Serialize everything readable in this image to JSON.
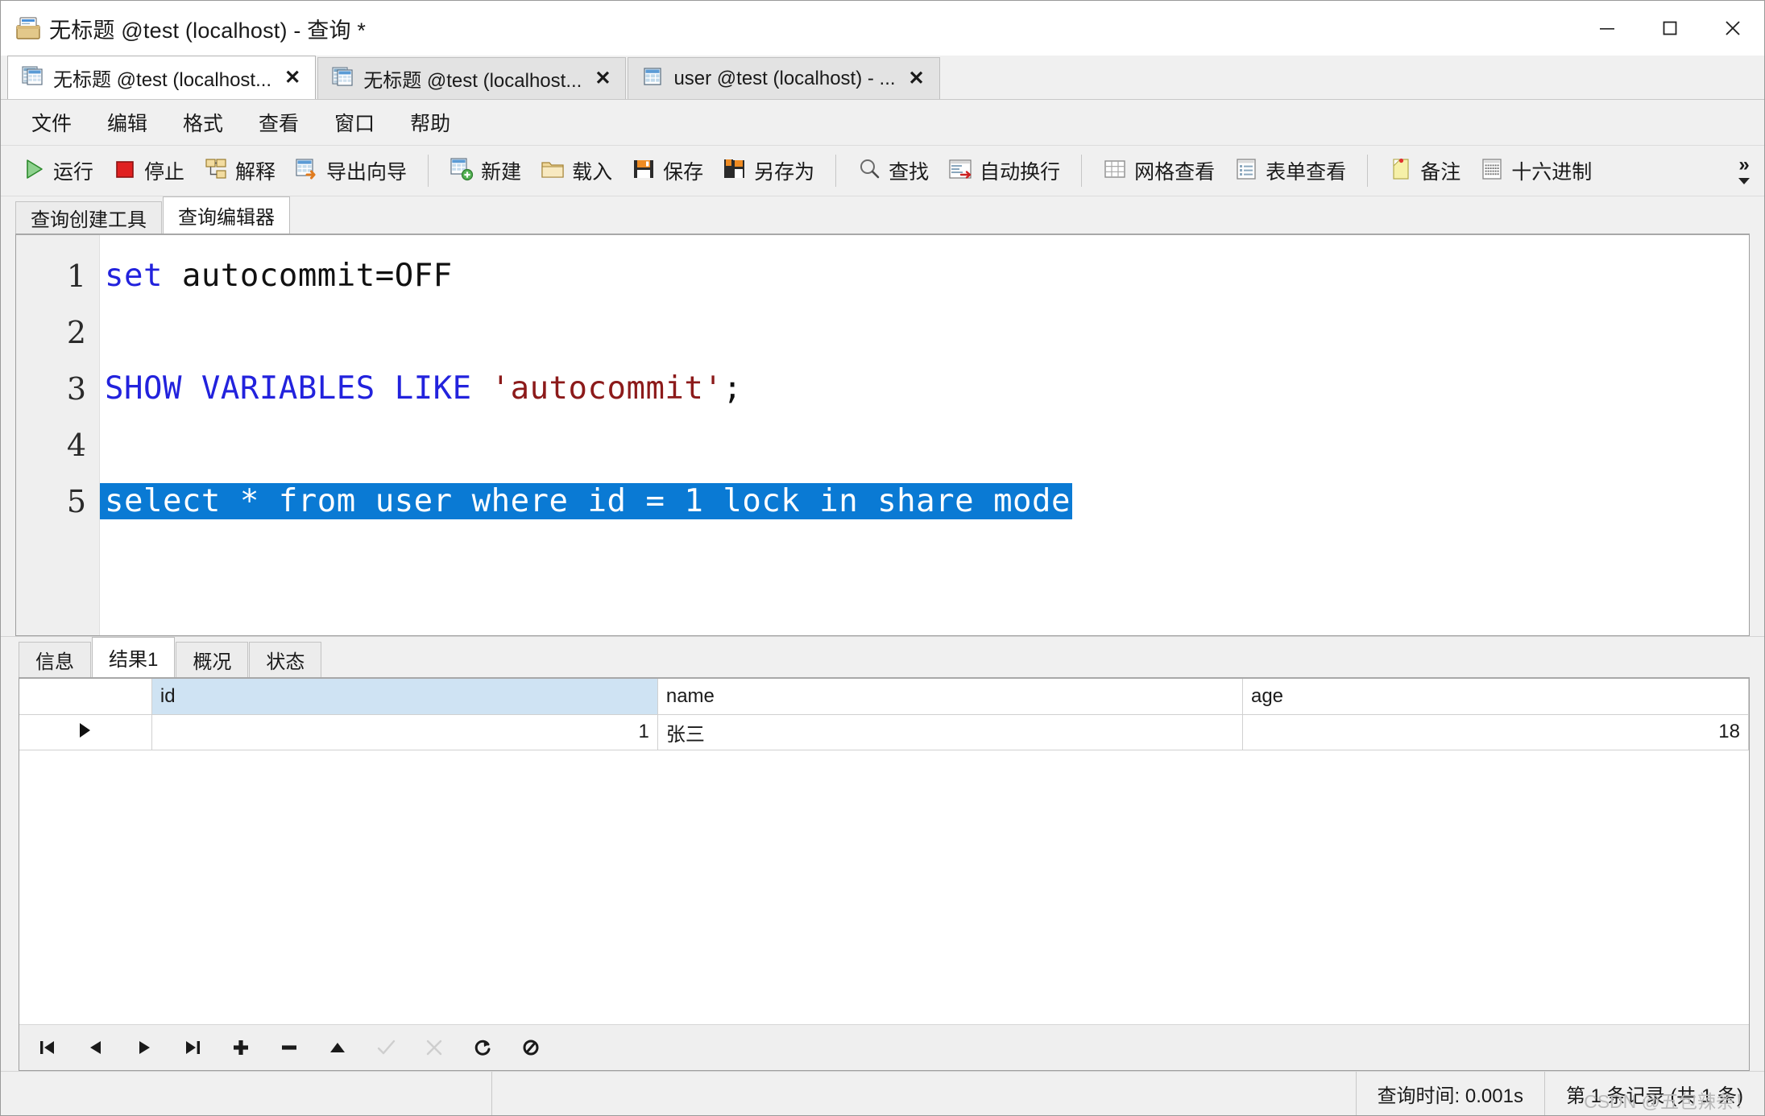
{
  "window": {
    "title": "无标题 @test (localhost) - 查询 *",
    "icon": "query-window-icon",
    "controls": {
      "minimize": "minimize-icon",
      "maximize": "maximize-icon",
      "close": "close-icon"
    }
  },
  "document_tabs": [
    {
      "label": "无标题 @test (localhost...",
      "close": "✕",
      "icon": "query-tab-icon",
      "active": true
    },
    {
      "label": "无标题 @test (localhost...",
      "close": "✕",
      "icon": "query-tab-icon",
      "active": false
    },
    {
      "label": "user @test (localhost) - ...",
      "close": "✕",
      "icon": "table-tab-icon",
      "active": false
    }
  ],
  "menubar": [
    {
      "label": "文件"
    },
    {
      "label": "编辑"
    },
    {
      "label": "格式"
    },
    {
      "label": "查看"
    },
    {
      "label": "窗口"
    },
    {
      "label": "帮助"
    }
  ],
  "toolbar": {
    "groups": [
      [
        {
          "label": "运行",
          "icon": "run-play-icon"
        },
        {
          "label": "停止",
          "icon": "stop-square-icon"
        },
        {
          "label": "解释",
          "icon": "explain-icon"
        },
        {
          "label": "导出向导",
          "icon": "export-wizard-icon"
        }
      ],
      [
        {
          "label": "新建",
          "icon": "new-query-icon"
        },
        {
          "label": "载入",
          "icon": "open-folder-icon"
        },
        {
          "label": "保存",
          "icon": "save-floppy-icon"
        },
        {
          "label": "另存为",
          "icon": "save-as-floppy-icon"
        }
      ],
      [
        {
          "label": "查找",
          "icon": "search-magnifier-icon"
        },
        {
          "label": "自动换行",
          "icon": "word-wrap-icon"
        }
      ],
      [
        {
          "label": "网格查看",
          "icon": "grid-view-icon"
        },
        {
          "label": "表单查看",
          "icon": "form-view-icon"
        }
      ],
      [
        {
          "label": "备注",
          "icon": "note-icon"
        },
        {
          "label": "十六进制",
          "icon": "hex-icon"
        }
      ]
    ],
    "overflow": {
      "chevron": "»",
      "icon": "chevron-double-right-icon",
      "dropdown": "chevron-down-icon"
    }
  },
  "editor": {
    "tabs": [
      {
        "label": "查询创建工具",
        "active": false
      },
      {
        "label": "查询编辑器",
        "active": true
      }
    ],
    "line_numbers": [
      "1",
      "2",
      "3",
      "4",
      "5"
    ],
    "lines": [
      {
        "n": "1",
        "tokens": [
          {
            "t": "set",
            "c": "kw"
          },
          {
            "t": " autocommit=OFF",
            "c": "plain"
          }
        ],
        "selected": false
      },
      {
        "n": "2",
        "tokens": [],
        "selected": false
      },
      {
        "n": "3",
        "tokens": [
          {
            "t": "SHOW VARIABLES LIKE ",
            "c": "kw"
          },
          {
            "t": "'autocommit'",
            "c": "str"
          },
          {
            "t": ";",
            "c": "plain"
          }
        ],
        "selected": false
      },
      {
        "n": "4",
        "tokens": [],
        "selected": false
      },
      {
        "n": "5",
        "tokens": [
          {
            "t": "select * from user where id = 1 lock in share mode",
            "c": "sel"
          }
        ],
        "selected": true
      }
    ],
    "selection_color": "#0a7ad4",
    "keyword_color": "#2222dd",
    "string_color": "#8c1a1a",
    "plain_color": "#111111"
  },
  "results": {
    "tabs": [
      {
        "label": "信息",
        "active": false
      },
      {
        "label": "结果1",
        "active": true
      },
      {
        "label": "概况",
        "active": false
      },
      {
        "label": "状态",
        "active": false
      }
    ],
    "grid": {
      "columns": [
        "id",
        "name",
        "age"
      ],
      "selected_column": "id",
      "rows": [
        {
          "marker": "▶",
          "id": "1",
          "name": "张三",
          "age": "18"
        }
      ]
    },
    "navbar": [
      {
        "icon": "first-record-icon",
        "label": "|◀",
        "disabled": false
      },
      {
        "icon": "previous-record-icon",
        "label": "◀",
        "disabled": false
      },
      {
        "icon": "next-record-icon",
        "label": "▶",
        "disabled": false
      },
      {
        "icon": "last-record-icon",
        "label": "▶|",
        "disabled": false
      },
      {
        "icon": "add-record-icon",
        "label": "+",
        "disabled": false
      },
      {
        "icon": "delete-record-icon",
        "label": "−",
        "disabled": false
      },
      {
        "icon": "edit-record-icon",
        "label": "▲",
        "disabled": false
      },
      {
        "icon": "apply-change-icon",
        "label": "✓",
        "disabled": true
      },
      {
        "icon": "cancel-change-icon",
        "label": "✗",
        "disabled": true
      },
      {
        "icon": "refresh-icon",
        "label": "↻",
        "disabled": false
      },
      {
        "icon": "stop-loading-icon",
        "label": "∅",
        "disabled": false
      }
    ]
  },
  "statusbar": {
    "query_time": "查询时间: 0.001s",
    "record_info": "第 1 条记录 (共 1 条)",
    "watermark": "CSDN @五包辣条！"
  }
}
